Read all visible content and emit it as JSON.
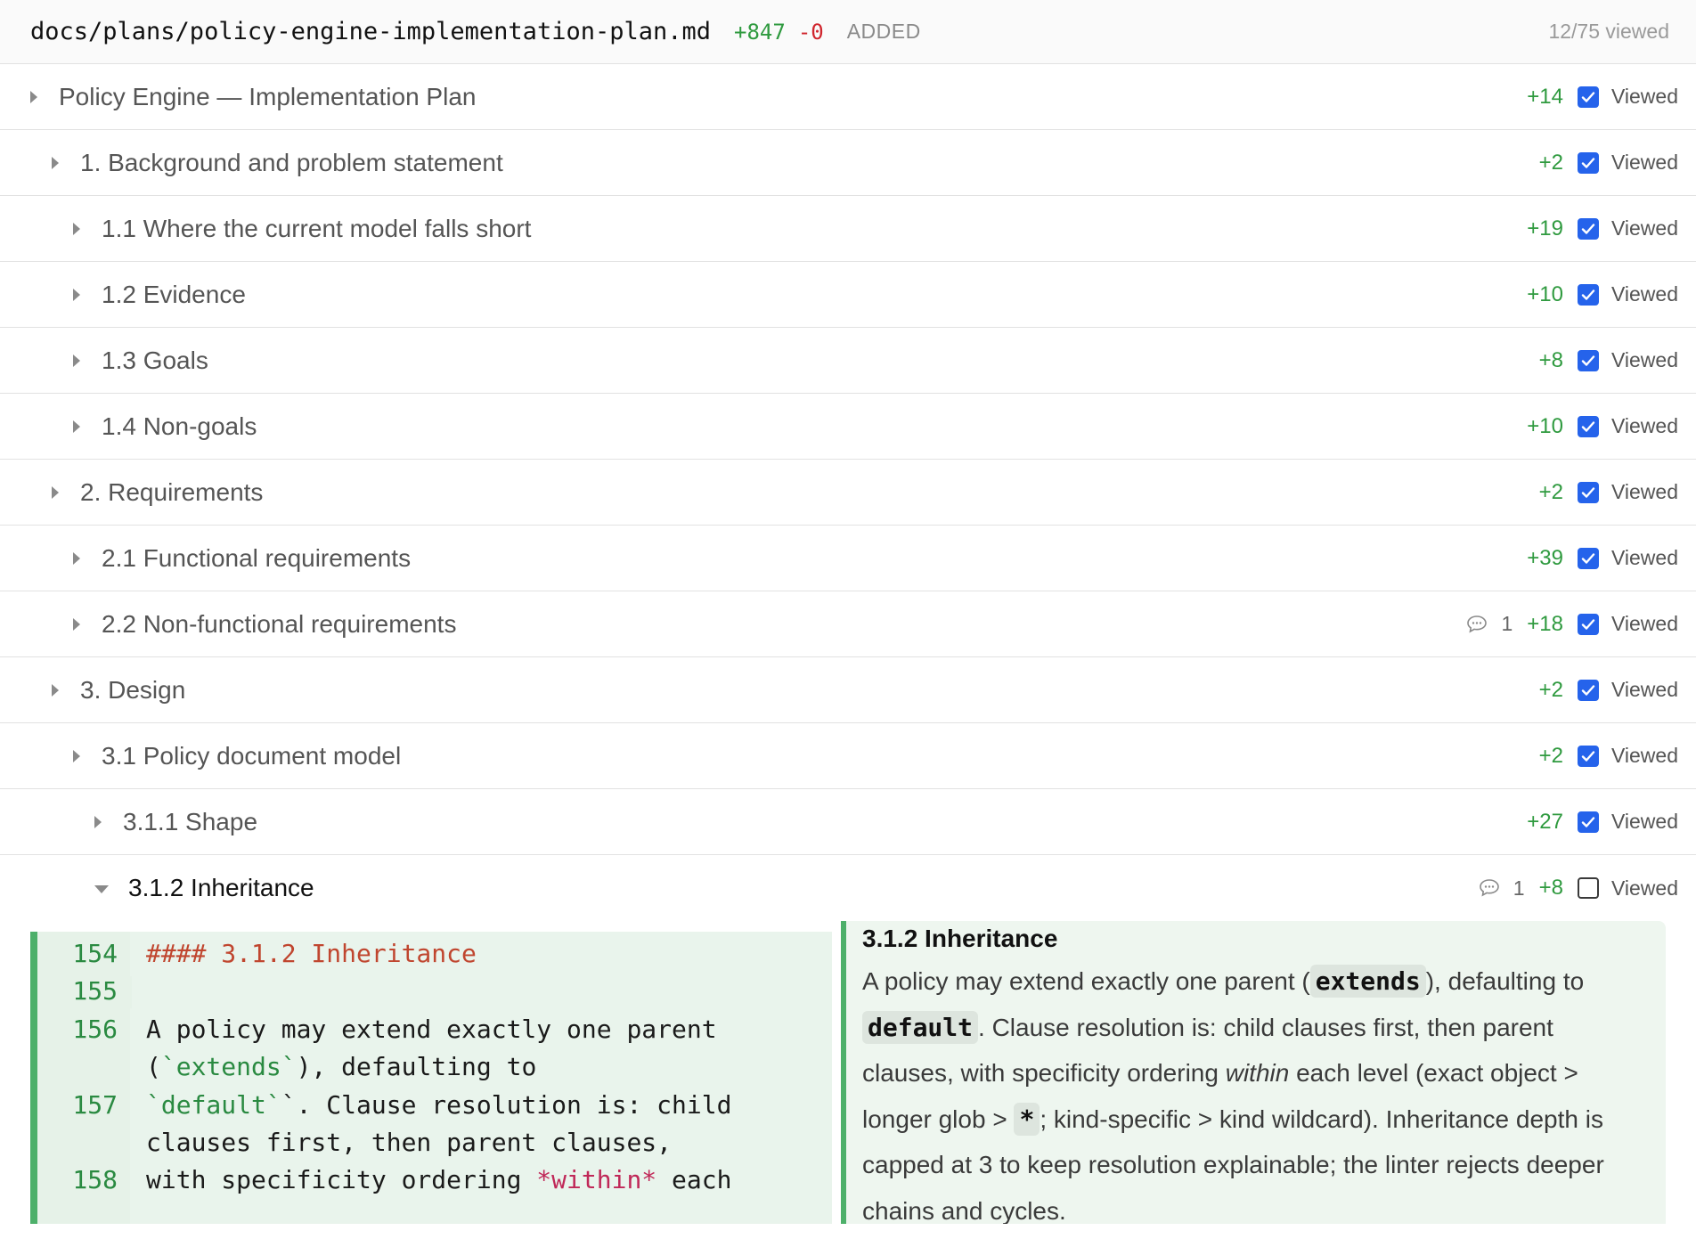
{
  "file": {
    "path": "docs/plans/policy-engine-implementation-plan.md",
    "additions": "+847",
    "deletions": "-0",
    "status": "ADDED",
    "viewed_progress": "12/75 viewed"
  },
  "sections": [
    {
      "title": "Policy Engine — Implementation Plan",
      "added": "+14",
      "viewed": true,
      "level": 0
    },
    {
      "title": "1. Background and problem statement",
      "added": "+2",
      "viewed": true,
      "level": 1
    },
    {
      "title": "1.1 Where the current model falls short",
      "added": "+19",
      "viewed": true,
      "level": 2
    },
    {
      "title": "1.2 Evidence",
      "added": "+10",
      "viewed": true,
      "level": 2
    },
    {
      "title": "1.3 Goals",
      "added": "+8",
      "viewed": true,
      "level": 2
    },
    {
      "title": "1.4 Non-goals",
      "added": "+10",
      "viewed": true,
      "level": 2
    },
    {
      "title": "2. Requirements",
      "added": "+2",
      "viewed": true,
      "level": 1
    },
    {
      "title": "2.1 Functional requirements",
      "added": "+39",
      "viewed": true,
      "level": 2
    },
    {
      "title": "2.2 Non-functional requirements",
      "added": "+18",
      "viewed": true,
      "comments": "1",
      "level": 2
    },
    {
      "title": "3. Design",
      "added": "+2",
      "viewed": true,
      "level": 1
    },
    {
      "title": "3.1 Policy document model",
      "added": "+2",
      "viewed": true,
      "level": 2
    },
    {
      "title": "3.1.1 Shape",
      "added": "+27",
      "viewed": true,
      "level": 3
    },
    {
      "title": "3.1.2 Inheritance",
      "added": "+8",
      "viewed": false,
      "comments": "1",
      "level": 3,
      "expanded": true
    }
  ],
  "viewed_label": "Viewed",
  "diff": {
    "line_numbers": [
      "154",
      "155",
      "156",
      "157",
      "158"
    ],
    "lines": [
      {
        "heading": "#### 3.1.2 Inheritance"
      },
      {
        "text": ""
      },
      {
        "text": "A policy may extend exactly one parent"
      },
      {
        "pre": "(",
        "code": "`extends`",
        "post": "), defaulting to"
      },
      {
        "code": "`default`",
        "post": "`. Clause resolution is: child"
      },
      {
        "text": "clauses first, then parent clauses,"
      },
      {
        "pre": "with specificity ordering ",
        "emph": "*within*",
        "post": " each"
      }
    ]
  },
  "preview": {
    "title": "3.1.2 Inheritance",
    "p1": "A policy may extend exactly one parent (",
    "code1": "extends",
    "p2": "), defaulting to",
    "code2": "default",
    "p3": ". Clause resolution is: child clauses first, then parent clauses, with specificity ordering ",
    "em": "within",
    "p4": " each level (exact object > longer glob > ",
    "code3": "*",
    "p5": "; kind-specific > kind wildcard). Inheritance depth is capped at 3 to keep resolution explainable; the linter rejects deeper chains and cycles."
  }
}
